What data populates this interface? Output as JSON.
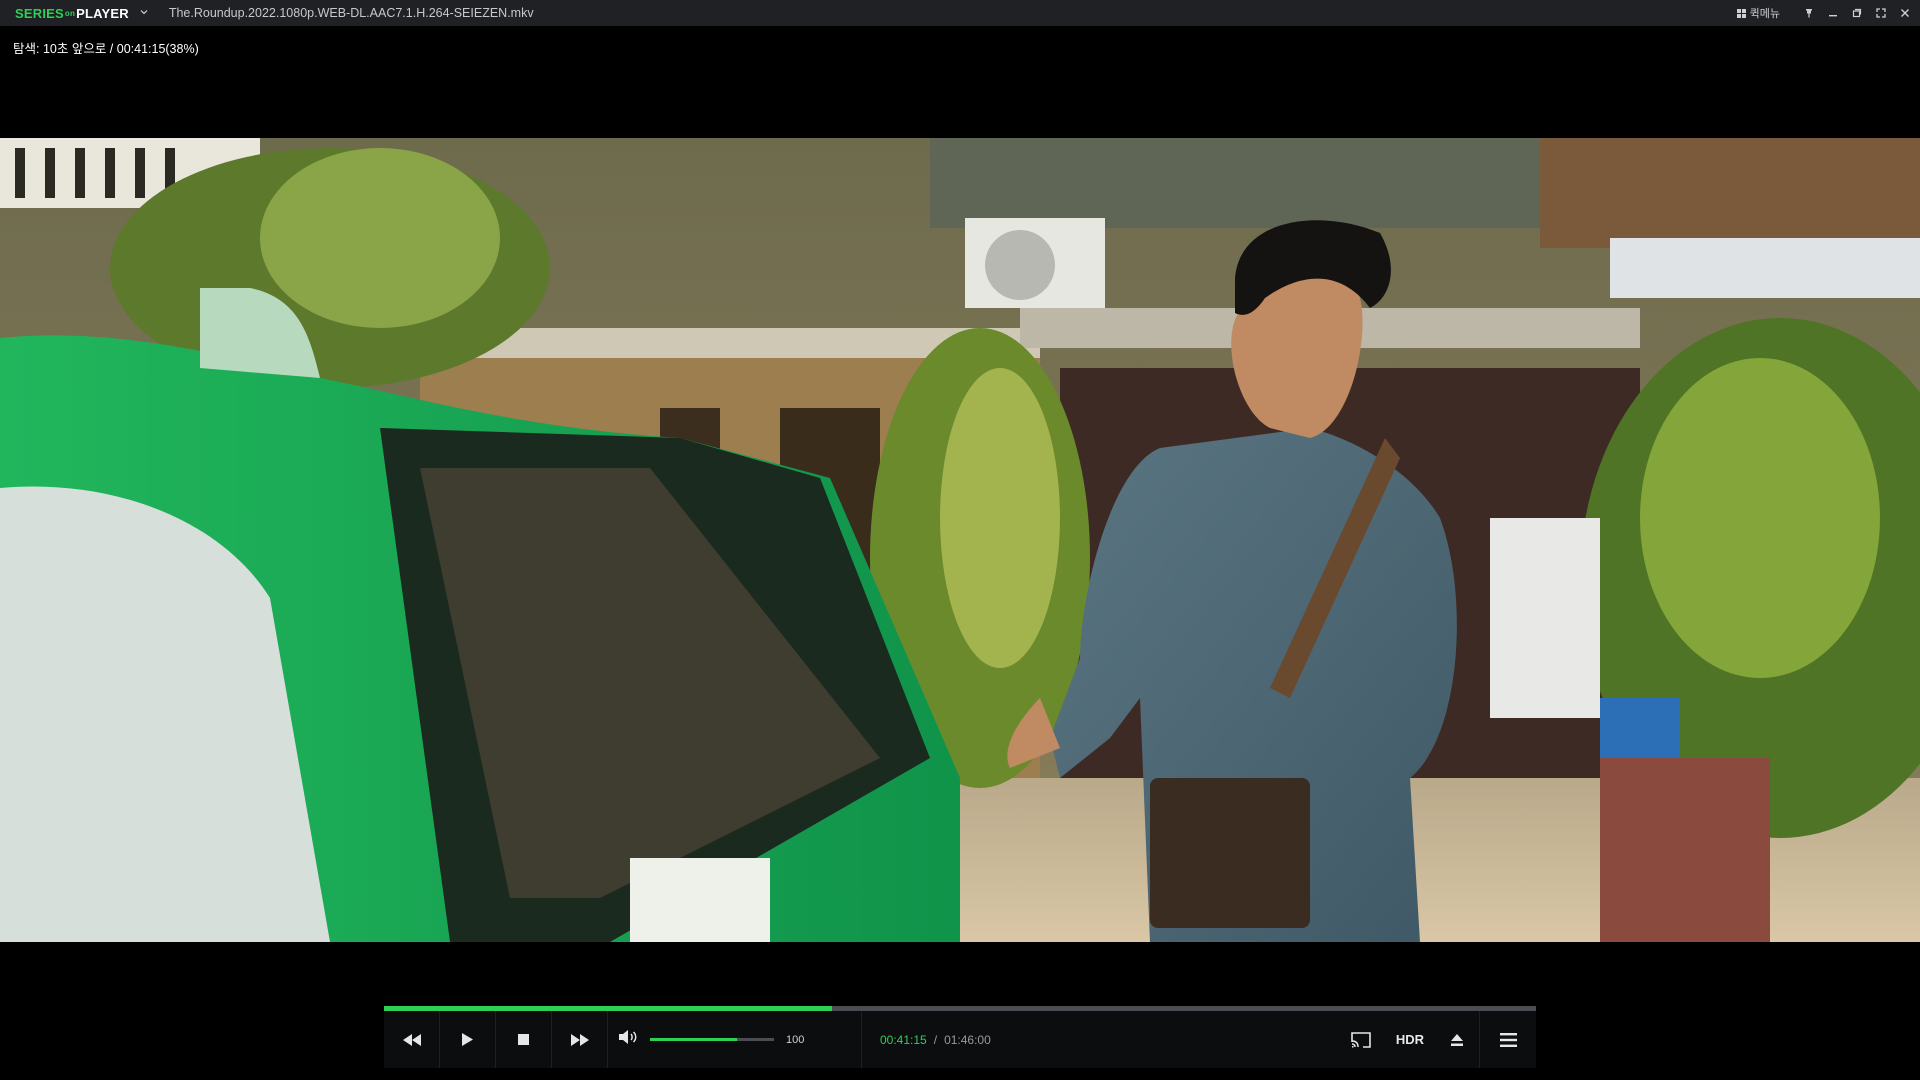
{
  "app": {
    "logo_series": "SERIES",
    "logo_on": "on",
    "logo_player": "PLAYER",
    "filename": "The.Roundup.2022.1080p.WEB-DL.AAC7.1.H.264-SEIEZEN.mkv",
    "quick_menu_label": "퀵메뉴",
    "window_icons": [
      "grid-icon",
      "pin-icon",
      "minimize-icon",
      "restore-icon",
      "fullscreen-icon",
      "close-icon"
    ]
  },
  "osd": {
    "text": "탐색: 10초 앞으로 / 00:41:15(38%)"
  },
  "player": {
    "progress": 0.389,
    "volume_value": "100",
    "volume_level": 0.7,
    "current_time": "00:41:15",
    "time_separator": "/",
    "total_time": "01:46:00",
    "hdr_label": "HDR",
    "accent_color": "#2fcf57",
    "buttons": [
      "rewind-icon",
      "play-icon",
      "stop-icon",
      "fast-forward-icon",
      "volume-icon",
      "screen-mirror-icon",
      "eject-icon",
      "menu-icon"
    ]
  }
}
